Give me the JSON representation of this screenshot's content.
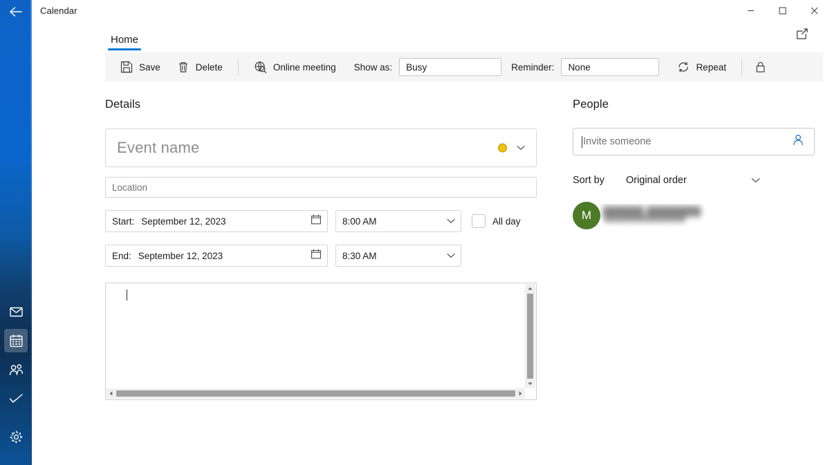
{
  "window": {
    "title": "Calendar",
    "controls": {
      "minimize": "minimize-icon",
      "maximize": "maximize-icon",
      "close": "close-icon"
    },
    "back_icon": "back-arrow-icon",
    "popout_icon": "open-in-new-window-icon"
  },
  "rail": {
    "items": [
      {
        "name": "mail",
        "icon": "mail-icon",
        "selected": false
      },
      {
        "name": "calendar",
        "icon": "calendar-icon",
        "selected": true
      },
      {
        "name": "people",
        "icon": "people-icon",
        "selected": false
      },
      {
        "name": "to-do",
        "icon": "checkmark-icon",
        "selected": false
      },
      {
        "name": "settings",
        "icon": "gear-icon",
        "selected": false
      }
    ]
  },
  "tabs": [
    {
      "label": "Home",
      "active": true
    }
  ],
  "ribbon": {
    "save_label": "Save",
    "save_icon": "save-floppy-icon",
    "delete_label": "Delete",
    "delete_icon": "trash-icon",
    "online_meeting_label": "Online meeting",
    "online_meeting_icon": "globe-meeting-icon",
    "show_as_label": "Show as:",
    "show_as_value": "Busy",
    "reminder_label": "Reminder:",
    "reminder_value": "None",
    "repeat_label": "Repeat",
    "repeat_icon": "repeat-icon",
    "private_icon": "lock-icon"
  },
  "details": {
    "section_title": "Details",
    "event_name_placeholder": "Event name",
    "event_name_value": "",
    "calendar_color": "#edc211",
    "color_chevron_icon": "chevron-down-icon",
    "location_placeholder": "Location",
    "location_value": "",
    "start_label": "Start:",
    "start_date": "September 12, 2023",
    "start_time": "8:00 AM",
    "end_label": "End:",
    "end_date": "September 12, 2023",
    "end_time": "8:30 AM",
    "calendar_picker_icon": "calendar-picker-icon",
    "all_day_label": "All day",
    "all_day_checked": false,
    "notes_value": ""
  },
  "people": {
    "section_title": "People",
    "invite_placeholder": "Invite someone",
    "invite_value": "",
    "invite_icon": "person-add-icon",
    "sort_by_label": "Sort by",
    "sort_by_value": "Original order",
    "sort_chevron_icon": "chevron-down-icon",
    "attendees": [
      {
        "initial": "M",
        "avatar_color": "#4c7a26",
        "name_redacted": "██████ ████████",
        "email_redacted": "██████████████"
      }
    ]
  },
  "colors": {
    "accent": "#0078d4",
    "ribbon_bg": "#f5f5f5",
    "rail_blue": "#0a64cb"
  }
}
